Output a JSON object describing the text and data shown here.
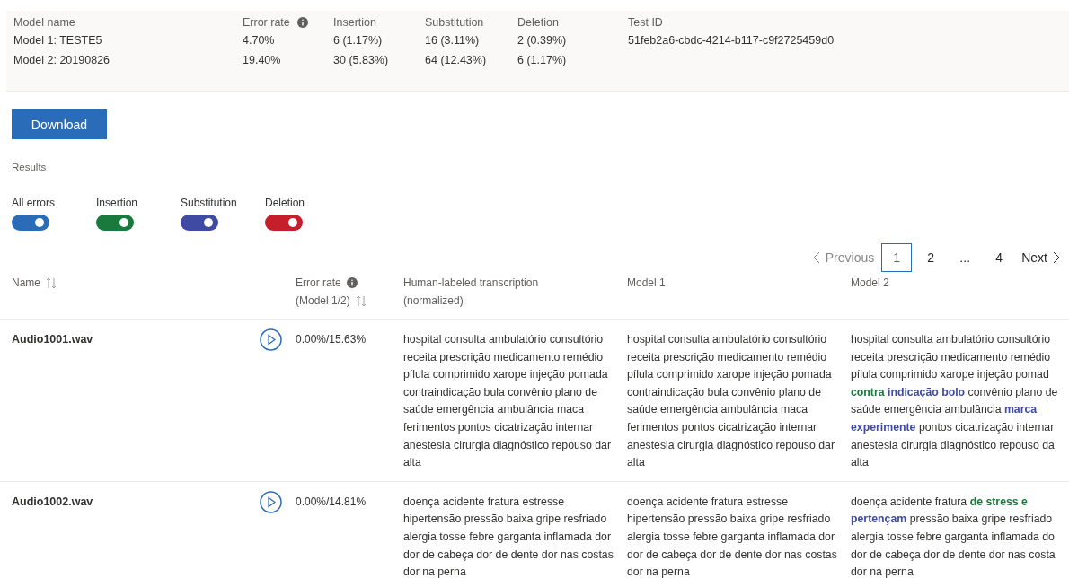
{
  "summary": {
    "columns": [
      "Model name",
      "Error rate",
      "Insertion",
      "Substitution",
      "Deletion",
      "Test ID"
    ],
    "rows": [
      [
        "Model 1: TESTE5",
        "4.70%",
        "6 (1.17%)",
        "16 (3.11%)",
        "2 (0.39%)",
        "51feb2a6-cbdc-4214-b117-c9f2725459d0"
      ],
      [
        "Model 2: 20190826",
        "19.40%",
        "30 (5.83%)",
        "64 (12.43%)",
        "6 (1.17%)"
      ]
    ]
  },
  "download_button": "Download",
  "results_label": "Results",
  "toggles": [
    {
      "label": "All errors",
      "on": true,
      "color": "#2b6cb8"
    },
    {
      "label": "Insertion",
      "on": true,
      "color": "#187a3c"
    },
    {
      "label": "Substitution",
      "on": true,
      "color": "#3f4aa3"
    },
    {
      "label": "Deletion",
      "on": true,
      "color": "#c41f2a"
    }
  ],
  "pagination": {
    "previous": "Previous",
    "pages": [
      {
        "label": "1",
        "selected": true
      },
      {
        "label": "2",
        "selected": false
      },
      {
        "label": "...",
        "selected": false
      },
      {
        "label": "4",
        "selected": false
      }
    ],
    "next": "Next"
  },
  "table": {
    "columns": {
      "name": "Name",
      "error_rate": [
        "Error rate",
        "(Model 1/2)"
      ],
      "human": [
        "Human-labeled transcription",
        "(normalized)"
      ],
      "model_1": "Model 1",
      "model_2": "Model 2"
    },
    "rows": [
      {
        "name": "Audio1001.wav",
        "error_rate": "0.00%/15.63%",
        "human": [
          "hospital consulta ambulatório consultório",
          "receita prescrição medicamento remédio",
          "pílula comprimido xarope injeção pomada",
          "contraindicação bula convênio plano de",
          "saúde emergência ambulância maca",
          "ferimentos pontos cicatrização internar",
          "anestesia cirurgia diagnóstico repouso dar",
          "alta"
        ],
        "model_1": [
          "hospital consulta ambulatório consultório",
          "receita prescrição medicamento remédio",
          "pílula comprimido xarope injeção pomada",
          "contraindicação bula convênio plano de",
          "saúde emergência ambulância maca",
          "ferimentos pontos cicatrização internar",
          "anestesia cirurgia diagnóstico repouso dar",
          "alta"
        ],
        "model_2": [
          [
            {
              "text": "hospital consulta ambulatório consultório",
              "kind": "plain"
            }
          ],
          [
            {
              "text": "receita prescrição medicamento remédio",
              "kind": "plain"
            }
          ],
          [
            {
              "text": "pílula comprimido xarope injeção pomad",
              "kind": "plain"
            }
          ],
          [
            {
              "text": "contra",
              "kind": "insertion"
            },
            {
              "text": "indicação bolo",
              "kind": "substitution"
            },
            {
              "text": "convênio plano de",
              "kind": "plain"
            }
          ],
          [
            {
              "text": "saúde emergência ambulância",
              "kind": "plain"
            },
            {
              "text": "marca",
              "kind": "substitution"
            }
          ],
          [
            {
              "text": "experimente",
              "kind": "substitution"
            },
            {
              "text": "pontos cicatrização internar",
              "kind": "plain"
            }
          ],
          [
            {
              "text": "anestesia cirurgia diagnóstico repouso da",
              "kind": "plain"
            }
          ],
          [
            {
              "text": "alta",
              "kind": "plain"
            }
          ]
        ]
      },
      {
        "name": "Audio1002.wav",
        "error_rate": "0.00%/14.81%",
        "human": [
          "doença acidente fratura estresse",
          "hipertensão pressão baixa gripe resfriado",
          "alergia tosse febre garganta inflamada dor",
          "dor de cabeça dor de dente dor nas costas",
          "dor na perna"
        ],
        "model_1": [
          "doença acidente fratura estresse",
          "hipertensão pressão baixa gripe resfriado",
          "alergia tosse febre garganta inflamada dor",
          "dor de cabeça dor de dente dor nas costas",
          "dor na perna"
        ],
        "model_2": [
          [
            {
              "text": "doença acidente fratura",
              "kind": "plain"
            },
            {
              "text": "de stress e",
              "kind": "insertion"
            }
          ],
          [
            {
              "text": "pertençam",
              "kind": "substitution"
            },
            {
              "text": "pressão baixa gripe resfriado",
              "kind": "plain"
            }
          ],
          [
            {
              "text": "alergia tosse febre garganta inflamada do",
              "kind": "plain"
            }
          ],
          [
            {
              "text": "dor de cabeça dor de dente dor nas costa",
              "kind": "plain"
            }
          ],
          [
            {
              "text": "dor na perna",
              "kind": "plain"
            }
          ]
        ]
      }
    ]
  }
}
